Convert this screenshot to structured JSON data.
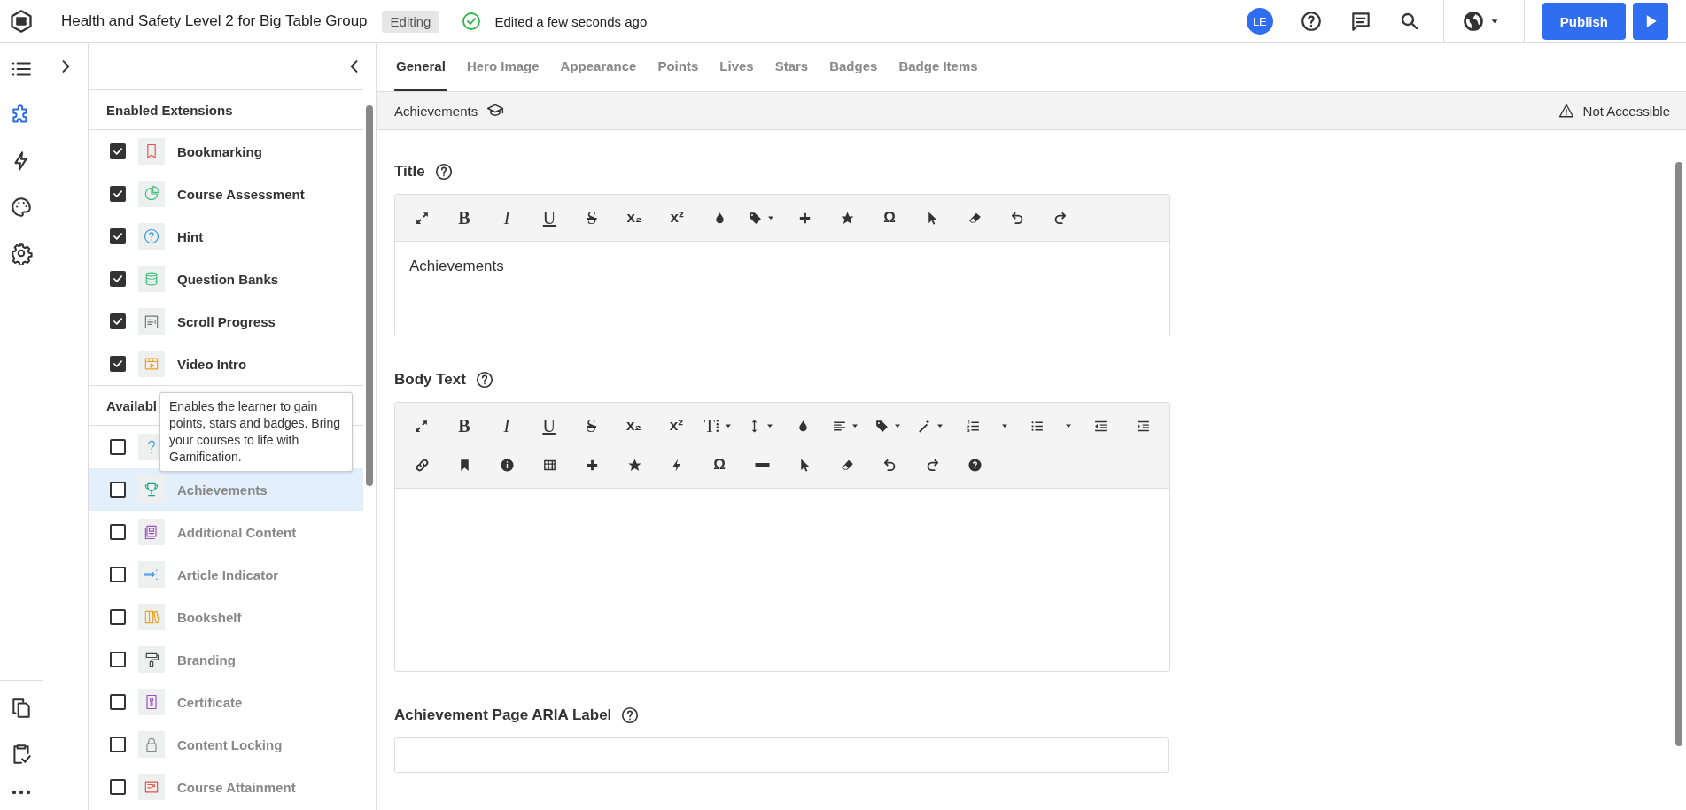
{
  "header": {
    "title": "Health and Safety Level 2 for Big Table Group",
    "status": "Editing",
    "saved": "Edited a few seconds ago",
    "avatar": "LE",
    "publish": "Publish"
  },
  "rail": {
    "top": [
      {
        "kind": "list",
        "selected": false
      },
      {
        "kind": "puzzle",
        "selected": true
      },
      {
        "kind": "bolt",
        "selected": false
      },
      {
        "kind": "palette",
        "selected": false
      },
      {
        "kind": "gear",
        "selected": false
      }
    ],
    "bottom": [
      {
        "kind": "copy",
        "selected": false
      },
      {
        "kind": "clipboard",
        "selected": false
      },
      {
        "kind": "dots",
        "selected": false
      }
    ]
  },
  "extensions": {
    "groups": [
      {
        "heading": "Enabled Extensions",
        "items": [
          {
            "name": "Bookmarking",
            "kind": "bookmark",
            "checked": true,
            "selected": false
          },
          {
            "name": "Course Assessment",
            "kind": "pie",
            "checked": true,
            "selected": false
          },
          {
            "name": "Hint",
            "kind": "hint",
            "checked": true,
            "selected": false
          },
          {
            "name": "Question Banks",
            "kind": "database",
            "checked": true,
            "selected": false
          },
          {
            "name": "Scroll Progress",
            "kind": "progress",
            "checked": true,
            "selected": false
          },
          {
            "name": "Video Intro",
            "kind": "video",
            "checked": true,
            "selected": false
          }
        ]
      },
      {
        "heading": "Availabl",
        "items": [
          {
            "kind": "question",
            "checked": false,
            "selected": false
          },
          {
            "name": "Achievements",
            "kind": "trophy",
            "checked": false,
            "selected": true
          },
          {
            "name": "Additional Content",
            "kind": "stack",
            "checked": false,
            "selected": false
          },
          {
            "name": "Article Indicator",
            "kind": "indicator",
            "checked": false,
            "selected": false
          },
          {
            "name": "Bookshelf",
            "kind": "books",
            "checked": false,
            "selected": false
          },
          {
            "name": "Branding",
            "kind": "roller",
            "checked": false,
            "selected": false
          },
          {
            "name": "Certificate",
            "kind": "certificate",
            "checked": false,
            "selected": false
          },
          {
            "name": "Content Locking",
            "kind": "lock",
            "checked": false,
            "selected": false
          },
          {
            "name": "Course Attainment",
            "kind": "card",
            "checked": false,
            "selected": false
          }
        ]
      }
    ],
    "tooltip": "Enables the learner to gain points, stars and badges. Bring your courses to life with Gamification."
  },
  "tabs": [
    {
      "label": "General",
      "selected": true
    },
    {
      "label": "Hero Image",
      "selected": false
    },
    {
      "label": "Appearance",
      "selected": false
    },
    {
      "label": "Points",
      "selected": false
    },
    {
      "label": "Lives",
      "selected": false
    },
    {
      "label": "Stars",
      "selected": false
    },
    {
      "label": "Badges",
      "selected": false
    },
    {
      "label": "Badge Items",
      "selected": false
    }
  ],
  "breadcrumb": {
    "label": "Achievements",
    "accessibility": "Not Accessible"
  },
  "fields": [
    {
      "label": "Title",
      "kind": "editor",
      "value": "Achievements",
      "toolbar": [
        [
          {
            "kind": "expand"
          },
          {
            "kind": "bold",
            "glyph": "B"
          },
          {
            "kind": "italic",
            "glyph": "I"
          },
          {
            "kind": "underline",
            "glyph": "U"
          },
          {
            "kind": "strike",
            "glyph": "S"
          },
          {
            "kind": "sub",
            "glyph": "x₂"
          },
          {
            "kind": "sup",
            "glyph": "x²"
          },
          {
            "kind": "drop"
          },
          {
            "kind": "tag",
            "caret": true
          },
          {
            "kind": "plus"
          },
          {
            "kind": "star"
          },
          {
            "kind": "omega",
            "glyph": "Ω"
          },
          {
            "kind": "cursor"
          },
          {
            "kind": "eraser"
          },
          {
            "kind": "undo"
          },
          {
            "kind": "redo"
          }
        ]
      ]
    },
    {
      "label": "Body Text",
      "kind": "editor",
      "toolbar": [
        [
          {
            "kind": "expand"
          },
          {
            "kind": "bold",
            "glyph": "B"
          },
          {
            "kind": "italic",
            "glyph": "I"
          },
          {
            "kind": "underline",
            "glyph": "U"
          },
          {
            "kind": "strike",
            "glyph": "S"
          },
          {
            "kind": "sub",
            "glyph": "x₂"
          },
          {
            "kind": "sup",
            "glyph": "x²"
          },
          {
            "kind": "fontsize",
            "glyph": "T⁞",
            "caret": true
          },
          {
            "kind": "lineheight",
            "caret": true
          },
          {
            "kind": "drop"
          },
          {
            "kind": "align",
            "caret": true
          },
          {
            "kind": "tag",
            "caret": true
          },
          {
            "kind": "magic",
            "caret": true
          },
          {
            "kind": "ol"
          },
          {
            "kind": "caret"
          },
          {
            "kind": "ul"
          },
          {
            "kind": "caret"
          },
          {
            "kind": "outdent"
          },
          {
            "kind": "indent"
          }
        ],
        [
          {
            "kind": "link"
          },
          {
            "kind": "bookmark"
          },
          {
            "kind": "info"
          },
          {
            "kind": "table"
          },
          {
            "kind": "plus"
          },
          {
            "kind": "star"
          },
          {
            "kind": "bolt"
          },
          {
            "kind": "omega",
            "glyph": "Ω"
          },
          {
            "kind": "minus"
          },
          {
            "kind": "cursor"
          },
          {
            "kind": "eraser"
          },
          {
            "kind": "undo"
          },
          {
            "kind": "redo"
          },
          {
            "kind": "help"
          }
        ]
      ]
    },
    {
      "label": "Achievement Page ARIA Label",
      "kind": "input"
    }
  ]
}
